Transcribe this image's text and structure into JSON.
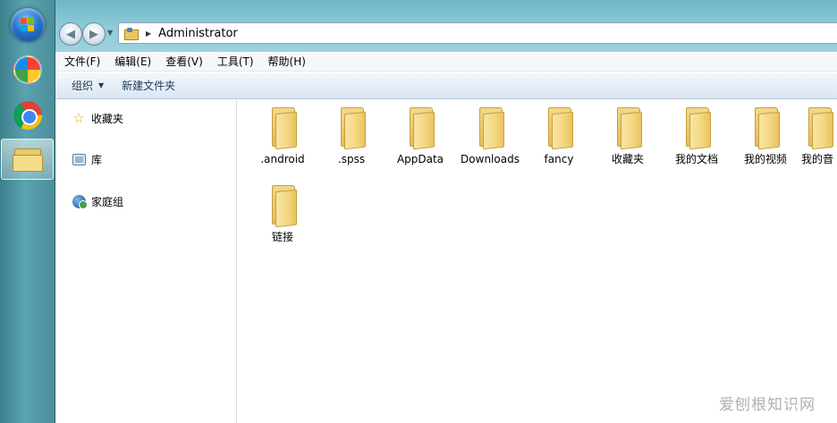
{
  "address": {
    "path": "Administrator"
  },
  "menu": [
    "文件(F)",
    "编辑(E)",
    "查看(V)",
    "工具(T)",
    "帮助(H)"
  ],
  "toolbar": {
    "organize": "组织",
    "new_folder": "新建文件夹"
  },
  "navpane": {
    "favorites": "收藏夹",
    "libraries": "库",
    "homegroup": "家庭组"
  },
  "folders": [
    ".android",
    ".spss",
    "AppData",
    "Downloads",
    "fancy",
    "收藏夹",
    "我的文档",
    "我的视频",
    "我的音",
    "链接"
  ],
  "watermark": "爱刨根知识网",
  "colors": {
    "folder": "#f3d57f",
    "taskbar": "#4b8e9b",
    "titlebar": "#8ccbd8",
    "toolbar_text": "#1e395b"
  }
}
